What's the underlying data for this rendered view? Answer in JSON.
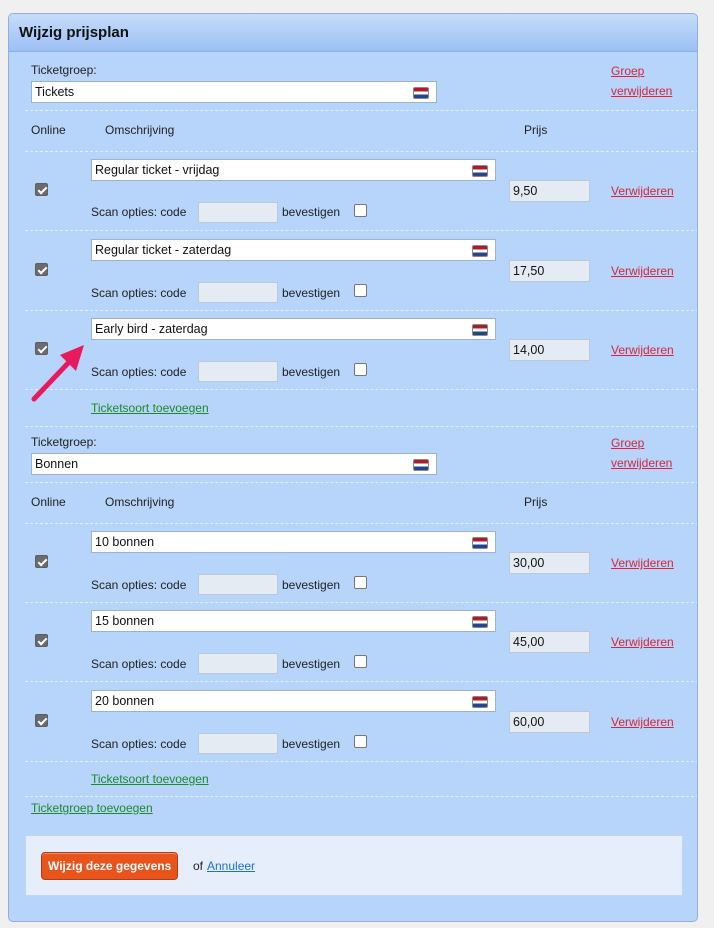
{
  "panel": {
    "title": "Wijzig prijsplan"
  },
  "labels": {
    "ticketgroup": "Ticketgroep:",
    "col_online": "Online",
    "col_description": "Omschrijving",
    "col_price": "Prijs",
    "scan_options": "Scan opties: code",
    "confirm": "bevestigen"
  },
  "groups": [
    {
      "name": "Tickets",
      "remove_link": [
        "Groep",
        "verwijderen"
      ],
      "tickets": [
        {
          "online": true,
          "name": "Regular ticket - vrijdag",
          "price": "9,50",
          "scan_code": "",
          "confirm": false,
          "remove_label": "Verwijderen"
        },
        {
          "online": true,
          "name": "Regular ticket - zaterdag",
          "price": "17,50",
          "scan_code": "",
          "confirm": false,
          "remove_label": "Verwijderen"
        },
        {
          "online": true,
          "name": "Early bird - zaterdag",
          "price": "14,00",
          "scan_code": "",
          "confirm": false,
          "remove_label": "Verwijderen"
        }
      ],
      "add_ticket_label": "Ticketsoort toevoegen"
    },
    {
      "name": "Bonnen",
      "remove_link": [
        "Groep",
        "verwijderen"
      ],
      "tickets": [
        {
          "online": true,
          "name": "10 bonnen",
          "price": "30,00",
          "scan_code": "",
          "confirm": false,
          "remove_label": "Verwijderen"
        },
        {
          "online": true,
          "name": "15 bonnen",
          "price": "45,00",
          "scan_code": "",
          "confirm": false,
          "remove_label": "Verwijderen"
        },
        {
          "online": true,
          "name": "20 bonnen",
          "price": "60,00",
          "scan_code": "",
          "confirm": false,
          "remove_label": "Verwijderen"
        }
      ],
      "add_ticket_label": "Ticketsoort toevoegen"
    }
  ],
  "add_group_label": "Ticketgroep toevoegen",
  "footer": {
    "submit_label": "Wijzig deze gegevens",
    "or_text": "of",
    "cancel_label": "Annuleer"
  },
  "colors": {
    "panel_bg": "#b7d4fa",
    "remove_link": "#d7263d",
    "add_link": "#1d8a2a",
    "submit_bg": "#e8541b",
    "annotation_arrow": "#e8195d"
  },
  "icons": {
    "language_flag": "dutch-flag-icon",
    "annotation": "pink-arrow-annotation"
  }
}
